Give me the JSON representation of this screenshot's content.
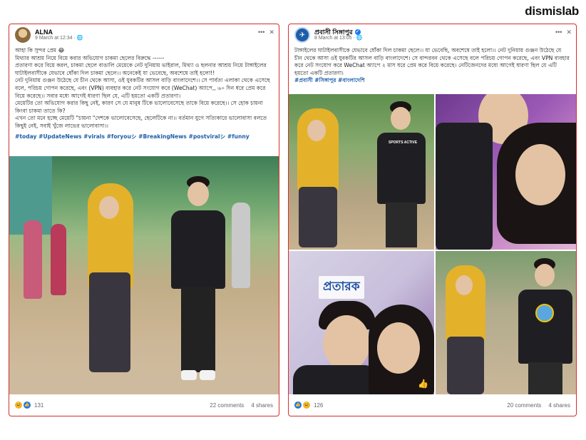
{
  "brand": "dismislab",
  "left_post": {
    "author": "ALNA",
    "time": "9 March at 12:34 · ",
    "lines": [
      "আহা কি সুন্দর প্রেম 😂",
      "মিথ্যার আশ্রয় নিয়ে বিয়ে করার অভিযোগ চাকমা ছেলের বিরুদ্ধে ------",
      "প্রতারণা করে বিয়ে করল, চাকমা ছেলে বাঙালি মেয়েকে নেট দুনিয়ায় ভাইরাল, মিথ্যা ও ছলনার আশ্রয় নিয়ে টাঙ্গাইলের ঘাটাইলবাসীকে যেভাবে ধোঁকা দিল চাকমা ছেলে।। অনেকেই যা ভেবেছে, অবশেষে তাই হলো!!",
      "নেট দুনিয়ায় গুঞ্জন উঠেছে যে চীন থেকে আসা, ওই যুবকটির আসল বাড়ি বাংলাদেশে।। সে পার্বত্য এলাকা থেকে এসেছে বলে, পরিচয় গোপন করেছে, এবং (VPN) ব্যবহার করে নেট সংযোগ করে (WeChat) অ্যাপে,, ৬০ দিন ধরে প্রেম করে বিয়ে করেছে।। সবার মধ্যে আগেই ধারণা ছিল যে, এটি হয়তো একটি প্রতারণা।",
      "মেয়েটির তো অভিযোগ করার কিছু নেই, কারণ সে যে মানুষ টিকে ভালোবেসেছে তাকে বিয়ে করেছে।। সে হোক চায়না কিংবা চাকমা তাতে কি?",
      "এখন তো মনে হচ্ছে মেয়েটি \"চায়না \"দেশকে ভালোবেসেছে, ছেলেটিকে না।। বর্তমান যুগে সত্যিকারে ভালোবাসা বলতে কিছুই নেই, সবাই খুঁজে লাভের ভালোবাসা।।"
    ],
    "hashtags": "#today #UpdateNews #virals #foryouシ #BreakingNews #postviralシ #funny",
    "reactions_count": "131",
    "comments": "22 comments",
    "shares": "4 shares"
  },
  "right_post": {
    "author": "প্রবাসী সিঙ্গাপুর",
    "time": "8 March at 13:05 · ",
    "body": "টাঙ্গাইলের ঘাটাইলবাসীকে যেভাবে ধোঁকা দিল চাকমা ছেলে।। যা ভেবেছি, অবশেষে তাই হলো।। নেট দুনিয়ায় গুঞ্জন উঠেছে যে চীন থেকে আসা ওই যুবকটির আসল বাড়ি বাংলাদেশে। সে বান্দরবন থেকে এসেছে বলে পরিচয় গোপন করেছে, এবং VPN ব্যবহার করে নেট সংযোগ করে WeChat অ্যাপে ২ মাস ধরে প্রেম করে বিয়ে করেছে। নেটিজেনদের মধ্যে আগেই ধারণা ছিল যে এটি হয়তো একটি প্রতারণা।",
    "hashtags": "#প্রবাসী #সিঙ্গাপুর #বাংলাদেশি",
    "stamp": "প্রতারক",
    "reactions_count": "126",
    "comments": "20 comments",
    "shares": "4 shares"
  },
  "icons": {
    "menu": "more-dots-icon",
    "close": "close-icon",
    "globe": "globe-icon"
  }
}
